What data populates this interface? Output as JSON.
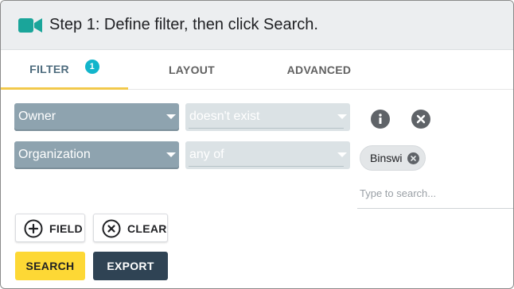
{
  "header": {
    "title": "Step 1: Define filter, then click Search.",
    "icon": "video-camera-icon",
    "icon_color": "#1aa59a"
  },
  "tabs": [
    {
      "label": "FILTER",
      "badge": "1",
      "active": true
    },
    {
      "label": "LAYOUT"
    },
    {
      "label": "ADVANCED"
    }
  ],
  "filters": [
    {
      "field": "Owner",
      "operator": "doesn't exist"
    },
    {
      "field": "Organization",
      "operator": "any of"
    }
  ],
  "values": {
    "chip_label": "Binswi",
    "search_placeholder": "Type to search..."
  },
  "actions": {
    "field_label": "FIELD",
    "clear_label": "CLEAR",
    "search_label": "SEARCH",
    "export_label": "EXPORT"
  },
  "colors": {
    "accent": "#fdd835",
    "badge": "#12b5cb",
    "select_dark": "#8ea3af",
    "export_bg": "#2f4354"
  }
}
